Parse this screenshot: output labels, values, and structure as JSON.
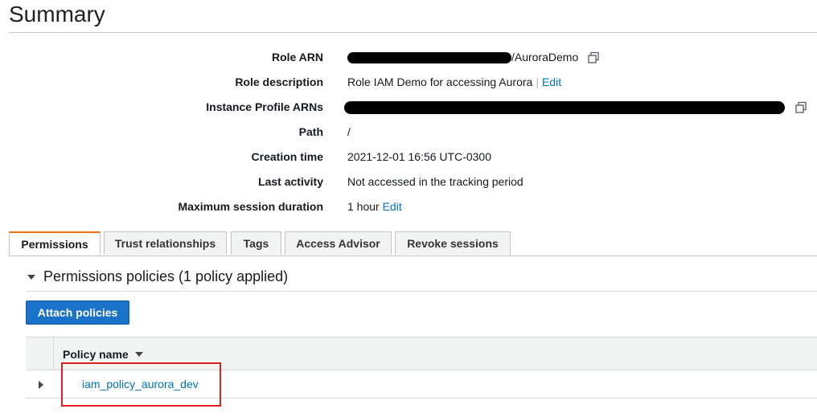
{
  "page": {
    "title": "Summary"
  },
  "summary": {
    "role_arn": {
      "label": "Role ARN",
      "suffix": "/AuroraDemo"
    },
    "role_description": {
      "label": "Role description",
      "value": "Role IAM Demo for accessing Aurora",
      "separator": "|",
      "edit": "Edit"
    },
    "instance_profile_arns": {
      "label": "Instance Profile ARNs"
    },
    "path": {
      "label": "Path",
      "value": "/"
    },
    "creation_time": {
      "label": "Creation time",
      "value": "2021-12-01 16:56 UTC-0300"
    },
    "last_activity": {
      "label": "Last activity",
      "value": "Not accessed in the tracking period"
    },
    "max_session": {
      "label": "Maximum session duration",
      "value": "1 hour",
      "edit": "Edit"
    }
  },
  "tabs": [
    {
      "label": "Permissions",
      "active": true
    },
    {
      "label": "Trust relationships",
      "active": false
    },
    {
      "label": "Tags",
      "active": false
    },
    {
      "label": "Access Advisor",
      "active": false
    },
    {
      "label": "Revoke sessions",
      "active": false
    }
  ],
  "permissions": {
    "section_title": "Permissions policies (1 policy applied)",
    "attach_button": "Attach policies",
    "table": {
      "column_header": "Policy name",
      "rows": [
        {
          "name": "iam_policy_aurora_dev"
        }
      ]
    }
  },
  "colors": {
    "link": "#0073bb",
    "primary_button": "#1a73c8",
    "active_tab_accent": "#ec7211",
    "highlight": "#e02020"
  },
  "icons": [
    "copy-icon",
    "caret-down-icon",
    "sort-caret-icon",
    "expand-caret-icon"
  ]
}
